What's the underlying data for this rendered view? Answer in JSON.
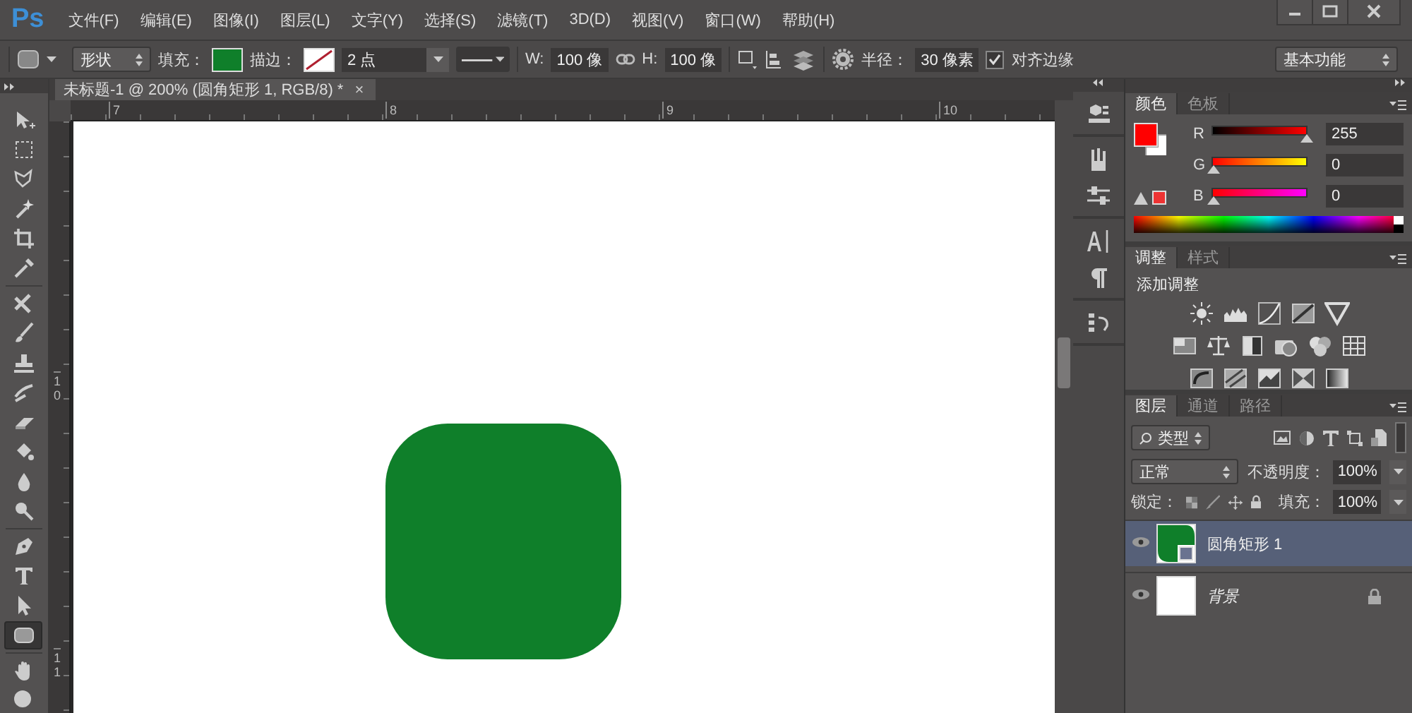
{
  "logo": "Ps",
  "menu": [
    "文件(F)",
    "编辑(E)",
    "图像(I)",
    "图层(L)",
    "文字(Y)",
    "选择(S)",
    "滤镜(T)",
    "3D(D)",
    "视图(V)",
    "窗口(W)",
    "帮助(H)"
  ],
  "options_bar": {
    "mode": "形状",
    "fill_label": "填充：",
    "stroke_label": "描边：",
    "stroke_width": "2 点",
    "w_label": "W:",
    "w_value": "100 像",
    "h_label": "H:",
    "h_value": "100 像",
    "radius_label": "半径：",
    "radius_value": "30 像素",
    "align_edges": {
      "label": "对齐边缘",
      "checked": true
    },
    "workspace": "基本功能"
  },
  "document_tab": {
    "title": "未标题-1 @ 200% (圆角矩形 1, RGB/8) *",
    "close": "×"
  },
  "rulers": {
    "horizontal": [
      "7",
      "8",
      "9",
      "10"
    ],
    "vertical": [
      "10",
      "11"
    ]
  },
  "tools": [
    {
      "kind": "move",
      "selected": false
    },
    {
      "kind": "marquee",
      "selected": false
    },
    {
      "kind": "lasso",
      "selected": false
    },
    {
      "kind": "wand",
      "selected": false
    },
    {
      "kind": "crop",
      "selected": false
    },
    {
      "kind": "eyedropper",
      "selected": false
    },
    {
      "kind": "healing",
      "selected": false
    },
    {
      "kind": "brush",
      "selected": false
    },
    {
      "kind": "stamp",
      "selected": false
    },
    {
      "kind": "history",
      "selected": false
    },
    {
      "kind": "eraser",
      "selected": false
    },
    {
      "kind": "bucket",
      "selected": false
    },
    {
      "kind": "blur",
      "selected": false
    },
    {
      "kind": "dodge",
      "selected": false
    },
    {
      "kind": "pen",
      "selected": false
    },
    {
      "kind": "type",
      "selected": false
    },
    {
      "kind": "path",
      "selected": false
    },
    {
      "kind": "shape",
      "selected": true
    },
    {
      "kind": "hand",
      "selected": false
    },
    {
      "kind": "zoom",
      "selected": false
    }
  ],
  "color_panel": {
    "tabs": [
      {
        "label": "颜色",
        "selected": true
      },
      {
        "label": "色板",
        "selected": false
      }
    ],
    "channels": [
      {
        "name": "R",
        "level": 1,
        "value": "255"
      },
      {
        "name": "G",
        "level": 0,
        "value": "0"
      },
      {
        "name": "B",
        "level": 0,
        "value": "0"
      }
    ]
  },
  "adjustments_panel": {
    "tabs": [
      {
        "label": "调整",
        "selected": true
      },
      {
        "label": "样式",
        "selected": false
      }
    ],
    "heading": "添加调整"
  },
  "layers_panel": {
    "tabs": [
      {
        "label": "图层",
        "selected": true
      },
      {
        "label": "通道",
        "selected": false
      },
      {
        "label": "路径",
        "selected": false
      }
    ],
    "filter": "类型",
    "blend_mode": "正常",
    "opacity_label": "不透明度：",
    "opacity": "100%",
    "lock_label": "锁定：",
    "fill_label": "填充：",
    "fill": "100%",
    "layers": [
      {
        "name": "圆角矩形 1",
        "kind": "shape",
        "selected": true,
        "visible": true
      },
      {
        "name": "背景",
        "kind": "background",
        "selected": false,
        "visible": true
      }
    ]
  }
}
